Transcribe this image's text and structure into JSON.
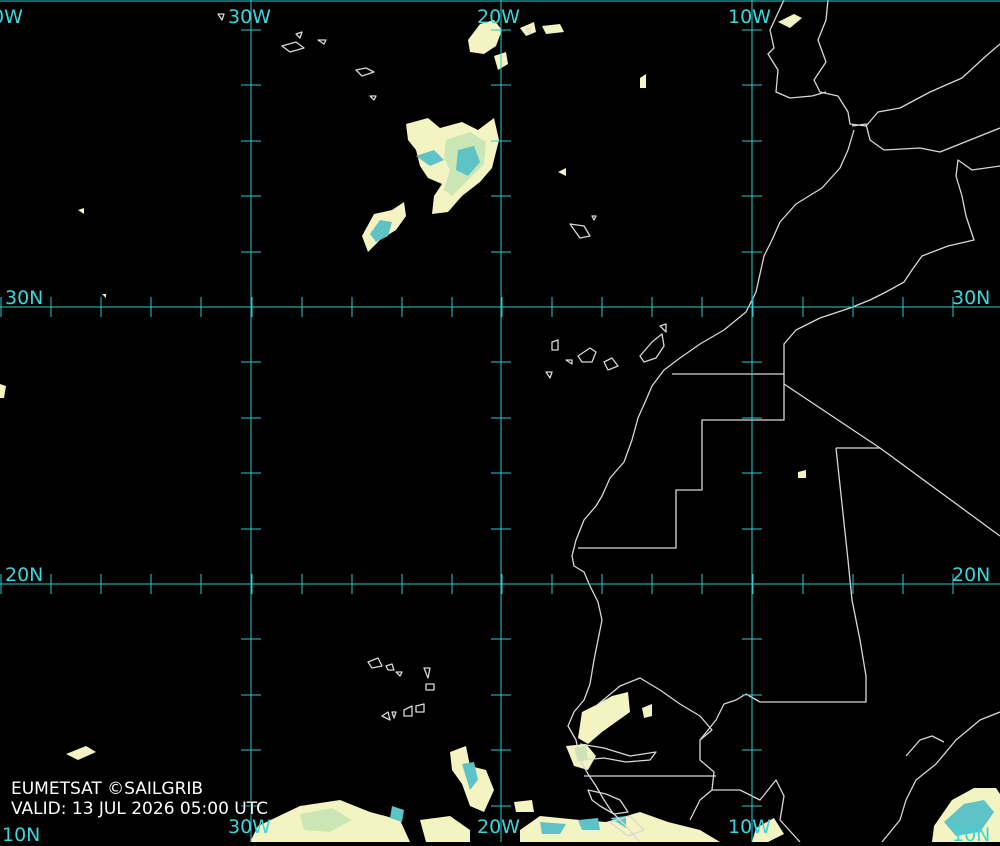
{
  "colors": {
    "background": "#000000",
    "graticule": "#2fc9d0",
    "coastline": "#d8d8d8",
    "cloud_light": "#f3f4c2",
    "cloud_mid": "#c9e6b4",
    "cloud_dense": "#5dc3c6"
  },
  "map": {
    "longitude_labels_top": [
      "30W",
      "20W",
      "10W"
    ],
    "longitude_labels_bottom": [
      "30W",
      "20W",
      "10W"
    ],
    "latitude_labels": [
      "30N",
      "20N"
    ],
    "clipped_labels": [
      "10N",
      "10N"
    ]
  },
  "footer": {
    "credit": "EUMETSAT ©SAILGRIB",
    "valid": "VALID:  13 JUL 2026 05:00 UTC"
  }
}
